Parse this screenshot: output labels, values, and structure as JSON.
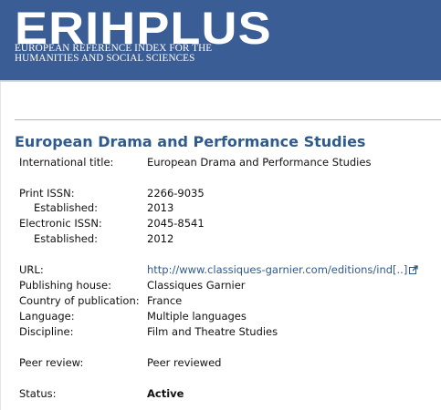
{
  "header": {
    "logo_text": "ERIHPLUS",
    "subtitle_line1": "EUROPEAN REFERENCE INDEX FOR THE",
    "subtitle_line2": "HUMANITIES AND SOCIAL SCIENCES"
  },
  "journal": {
    "title": "European Drama and Performance Studies",
    "rows": [
      {
        "label": "International title:",
        "value": "European Drama and Performance Studies"
      },
      {
        "label": "Print ISSN:",
        "value": "2266-9035"
      },
      {
        "label": "Established:",
        "value": "2013"
      },
      {
        "label": "Electronic ISSN:",
        "value": "2045-8541"
      },
      {
        "label": "Established:",
        "value": "2012"
      },
      {
        "label": "URL:",
        "value": "http://www.classiques-garnier.com/editions/ind[..]"
      },
      {
        "label": "Publishing house:",
        "value": "Classiques Garnier"
      },
      {
        "label": "Country of publication:",
        "value": "France"
      },
      {
        "label": "Language:",
        "value": "Multiple languages"
      },
      {
        "label": "Discipline:",
        "value": "Film and Theatre Studies"
      },
      {
        "label": "Peer review:",
        "value": "Peer reviewed"
      },
      {
        "label": "Status:",
        "value": "Active"
      }
    ]
  },
  "colors": {
    "header_bg": "#3b5d95",
    "title": "#2f5a8d",
    "link": "#2f5a8d"
  },
  "icons": {
    "external_link": "external-link-icon"
  }
}
